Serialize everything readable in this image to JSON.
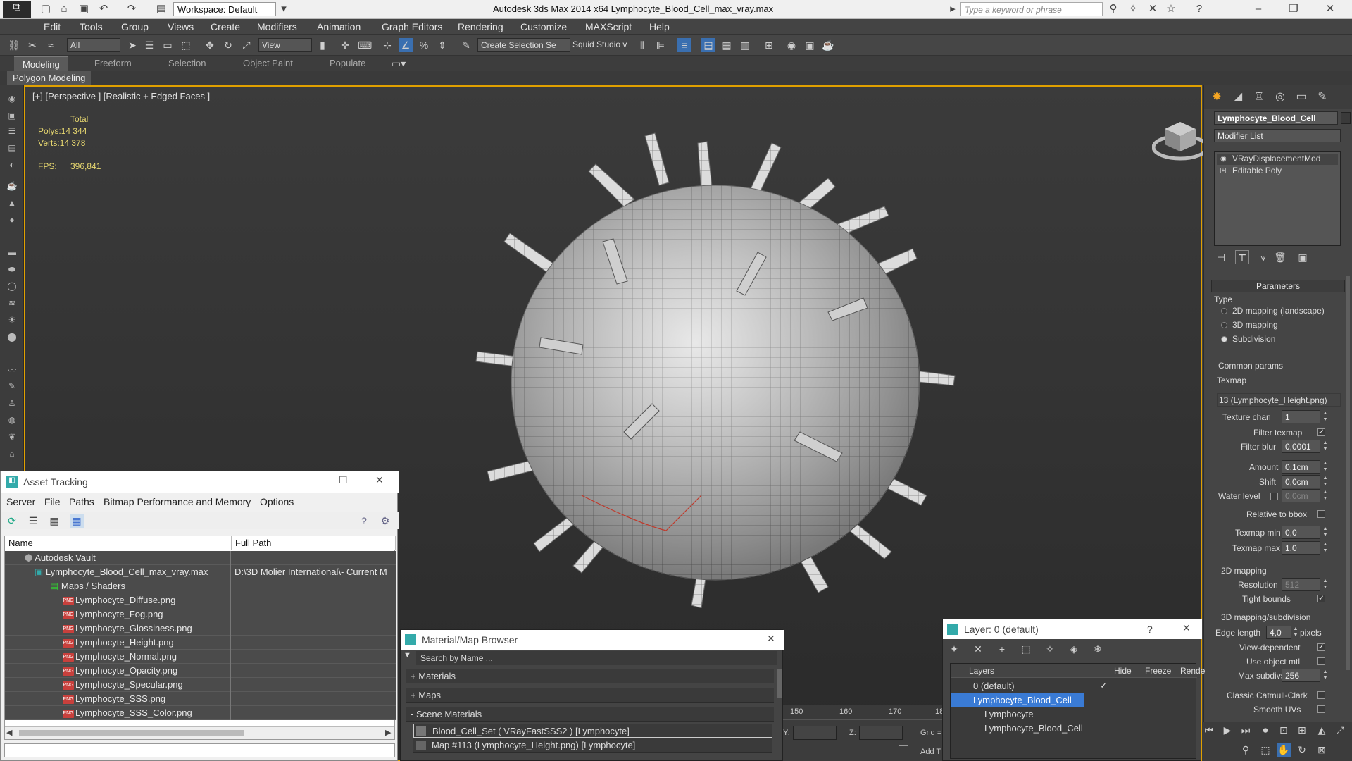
{
  "titlebar": {
    "workspace": "Workspace: Default",
    "title": "Autodesk 3ds Max  2014 x64     Lymphocyte_Blood_Cell_max_vray.max",
    "search_placeholder": "Type a keyword or phrase"
  },
  "menu": [
    "Edit",
    "Tools",
    "Group",
    "Views",
    "Create",
    "Modifiers",
    "Animation",
    "Graph Editors",
    "Rendering",
    "Customize",
    "MAXScript",
    "Help"
  ],
  "toolbar": {
    "filter": "All",
    "refcoord": "View",
    "selection_set": "Create Selection Se",
    "squid": "Squid Studio v"
  },
  "ribbon": {
    "tabs": [
      "Modeling",
      "Freeform",
      "Selection",
      "Object Paint",
      "Populate"
    ],
    "sub": "Polygon Modeling"
  },
  "viewport": {
    "label": "[+] [Perspective ] [Realistic + Edged Faces ]",
    "total": "Total",
    "polys_label": "Polys:",
    "polys": "14 344",
    "verts_label": "Verts:",
    "verts": "14 378",
    "fps_label": "FPS:",
    "fps": "396,841"
  },
  "cmd": {
    "object_name": "Lymphocyte_Blood_Cell",
    "modifier_list": "Modifier List",
    "stack": [
      "VRayDisplacementMod",
      "Editable Poly"
    ],
    "parameters": "Parameters",
    "type": "Type",
    "type_options": [
      "2D mapping (landscape)",
      "3D mapping",
      "Subdivision"
    ],
    "common": "Common params",
    "texmap": "Texmap",
    "texmap_value": "13 (Lymphocyte_Height.png)",
    "texture_chan_label": "Texture chan",
    "texture_chan": "1",
    "filter_texmap": "Filter texmap",
    "filter_blur_label": "Filter blur",
    "filter_blur": "0,0001",
    "amount_label": "Amount",
    "amount": "0,1cm",
    "shift_label": "Shift",
    "shift": "0,0cm",
    "water_label": "Water level",
    "water": "0,0cm",
    "rel_bbox": "Relative to bbox",
    "texmap_min_label": "Texmap min",
    "texmap_min": "0,0",
    "texmap_max_label": "Texmap max",
    "texmap_max": "1,0",
    "mapping2d": "2D mapping",
    "resolution_label": "Resolution",
    "resolution": "512",
    "tight": "Tight bounds",
    "mapping3d": "3D mapping/subdivision",
    "edge_label": "Edge length",
    "edge": "4,0",
    "pixels": "pixels",
    "view_dep": "View-dependent",
    "use_obj": "Use object mtl",
    "max_subdivs_label": "Max subdivs",
    "max_subdivs": "256",
    "catmull": "Classic Catmull-Clark",
    "smooth": "Smooth UVs"
  },
  "asset": {
    "title": "Asset Tracking",
    "menu": [
      "Server",
      "File",
      "Paths",
      "Bitmap Performance and Memory",
      "Options"
    ],
    "col_name": "Name",
    "col_path": "Full Path",
    "rows": [
      {
        "name": "Autodesk Vault",
        "path": ""
      },
      {
        "name": "Lymphocyte_Blood_Cell_max_vray.max",
        "path": "D:\\3D Molier International\\- Current M"
      },
      {
        "name": "Maps / Shaders",
        "path": ""
      },
      {
        "name": "Lymphocyte_Diffuse.png",
        "path": ""
      },
      {
        "name": "Lymphocyte_Fog.png",
        "path": ""
      },
      {
        "name": "Lymphocyte_Glossiness.png",
        "path": ""
      },
      {
        "name": "Lymphocyte_Height.png",
        "path": ""
      },
      {
        "name": "Lymphocyte_Normal.png",
        "path": ""
      },
      {
        "name": "Lymphocyte_Opacity.png",
        "path": ""
      },
      {
        "name": "Lymphocyte_Specular.png",
        "path": ""
      },
      {
        "name": "Lymphocyte_SSS.png",
        "path": ""
      },
      {
        "name": "Lymphocyte_SSS_Color.png",
        "path": ""
      }
    ]
  },
  "matbrowser": {
    "title": "Material/Map Browser",
    "search": "Search by Name ...",
    "sections": [
      "+ Materials",
      "+ Maps",
      "- Scene Materials"
    ],
    "items": [
      "Blood_Cell_Set  ( VRayFastSSS2 )  [Lymphocyte]",
      "Map #113 (Lymphocyte_Height.png)  [Lymphocyte]"
    ]
  },
  "layer": {
    "title": "Layer: 0 (default)",
    "col_layers": "Layers",
    "col_hide": "Hide",
    "col_freeze": "Freeze",
    "col_render": "Rende",
    "rows": [
      "0 (default)",
      "Lymphocyte_Blood_Cell",
      "Lymphocyte",
      "Lymphocyte_Blood_Cell"
    ]
  },
  "timeline": {
    "ticks": [
      "150",
      "160",
      "170",
      "18"
    ],
    "y_label": "Y:",
    "z_label": "Z:",
    "grid": "Grid =",
    "addt": "Add T"
  }
}
